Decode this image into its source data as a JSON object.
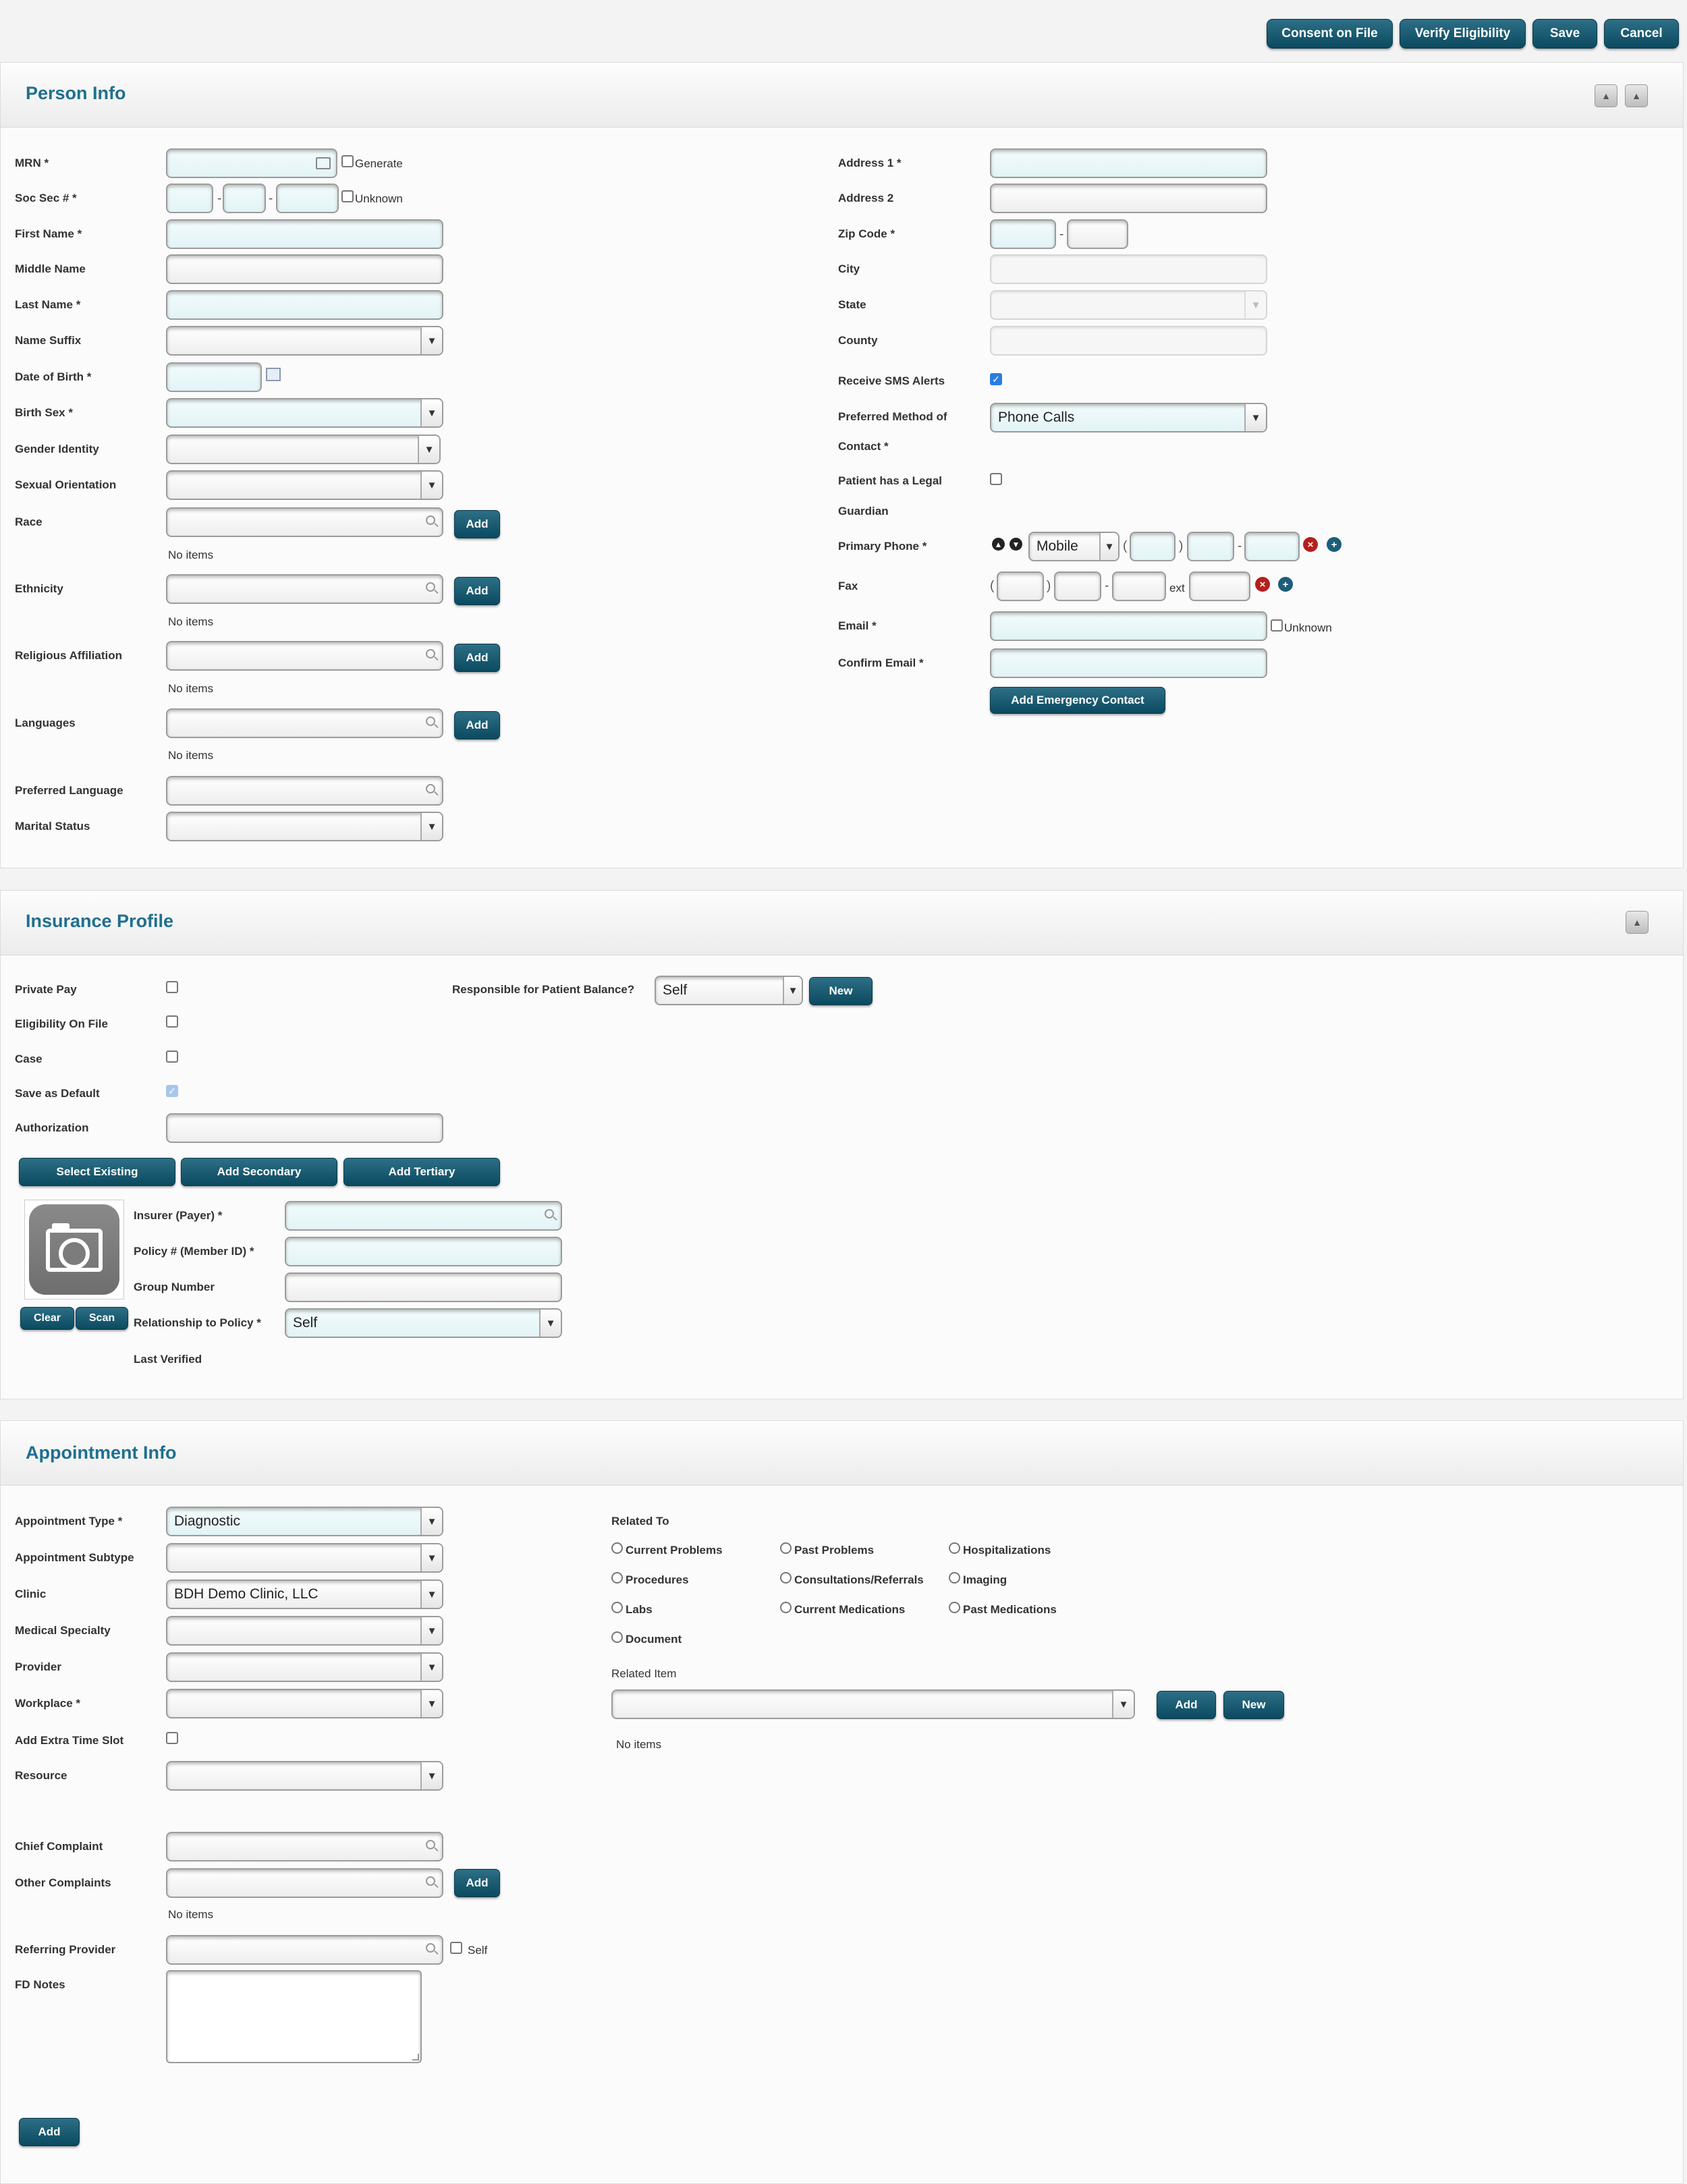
{
  "toolbar": {
    "consent": "Consent on File",
    "verify": "Verify Eligibility",
    "save": "Save",
    "cancel": "Cancel"
  },
  "person": {
    "title": "Person Info",
    "left": {
      "mrn": "MRN *",
      "generate": "Generate",
      "ssn": "Soc Sec # *",
      "unknown": "Unknown",
      "first": "First Name *",
      "middle": "Middle Name",
      "last": "Last Name *",
      "suffix": "Name Suffix",
      "dob": "Date of Birth *",
      "birth_sex": "Birth Sex *",
      "gender": "Gender Identity",
      "orientation": "Sexual Orientation",
      "race": "Race",
      "ethnicity": "Ethnicity",
      "religion": "Religious Affiliation",
      "languages": "Languages",
      "pref_lang": "Preferred Language",
      "marital": "Marital Status",
      "add": "Add",
      "no_items": "No items"
    },
    "right": {
      "addr1": "Address 1 *",
      "addr2": "Address 2",
      "zip": "Zip Code *",
      "city": "City",
      "state": "State",
      "county": "County",
      "sms": "Receive SMS Alerts",
      "pref_method_1": "Preferred Method of",
      "pref_method_2": "Contact *",
      "pref_method_value": "Phone Calls",
      "guardian_1": "Patient has a Legal",
      "guardian_2": "Guardian",
      "phone": "Primary Phone *",
      "phone_type": "Mobile",
      "fax": "Fax",
      "ext": "ext",
      "email": "Email *",
      "email_unknown": "Unknown",
      "confirm_email": "Confirm Email *",
      "emergency": "Add Emergency Contact"
    }
  },
  "insurance": {
    "title": "Insurance Profile",
    "private_pay": "Private Pay",
    "eligibility": "Eligibility On File",
    "case": "Case",
    "save_default": "Save as Default",
    "authorization": "Authorization",
    "responsible": "Responsible for Patient Balance?",
    "responsible_value": "Self",
    "new": "New",
    "select_existing": "Select Existing",
    "add_secondary": "Add Secondary",
    "add_tertiary": "Add Tertiary",
    "clear": "Clear",
    "scan": "Scan",
    "insurer": "Insurer (Payer) *",
    "policy": "Policy # (Member ID) *",
    "group": "Group Number",
    "relationship": "Relationship to Policy *",
    "relationship_value": "Self",
    "last_verified": "Last Verified"
  },
  "appointment": {
    "title": "Appointment Info",
    "type": "Appointment Type *",
    "type_value": "Diagnostic",
    "subtype": "Appointment Subtype",
    "clinic": "Clinic",
    "clinic_value": "BDH Demo Clinic, LLC",
    "specialty": "Medical Specialty",
    "provider": "Provider",
    "workplace": "Workplace *",
    "extra_slot": "Add Extra Time Slot",
    "resource": "Resource",
    "chief": "Chief Complaint",
    "other": "Other Complaints",
    "add": "Add",
    "no_items": "No items",
    "referring": "Referring Provider",
    "self": "Self",
    "notes": "FD Notes",
    "related_to": "Related To",
    "related_options": [
      "Current Problems",
      "Past Problems",
      "Hospitalizations",
      "Procedures",
      "Consultations/Referrals",
      "Imaging",
      "Labs",
      "Current Medications",
      "Past Medications",
      "Document"
    ],
    "related_item": "Related Item",
    "new": "New",
    "bottom_add": "Add"
  }
}
